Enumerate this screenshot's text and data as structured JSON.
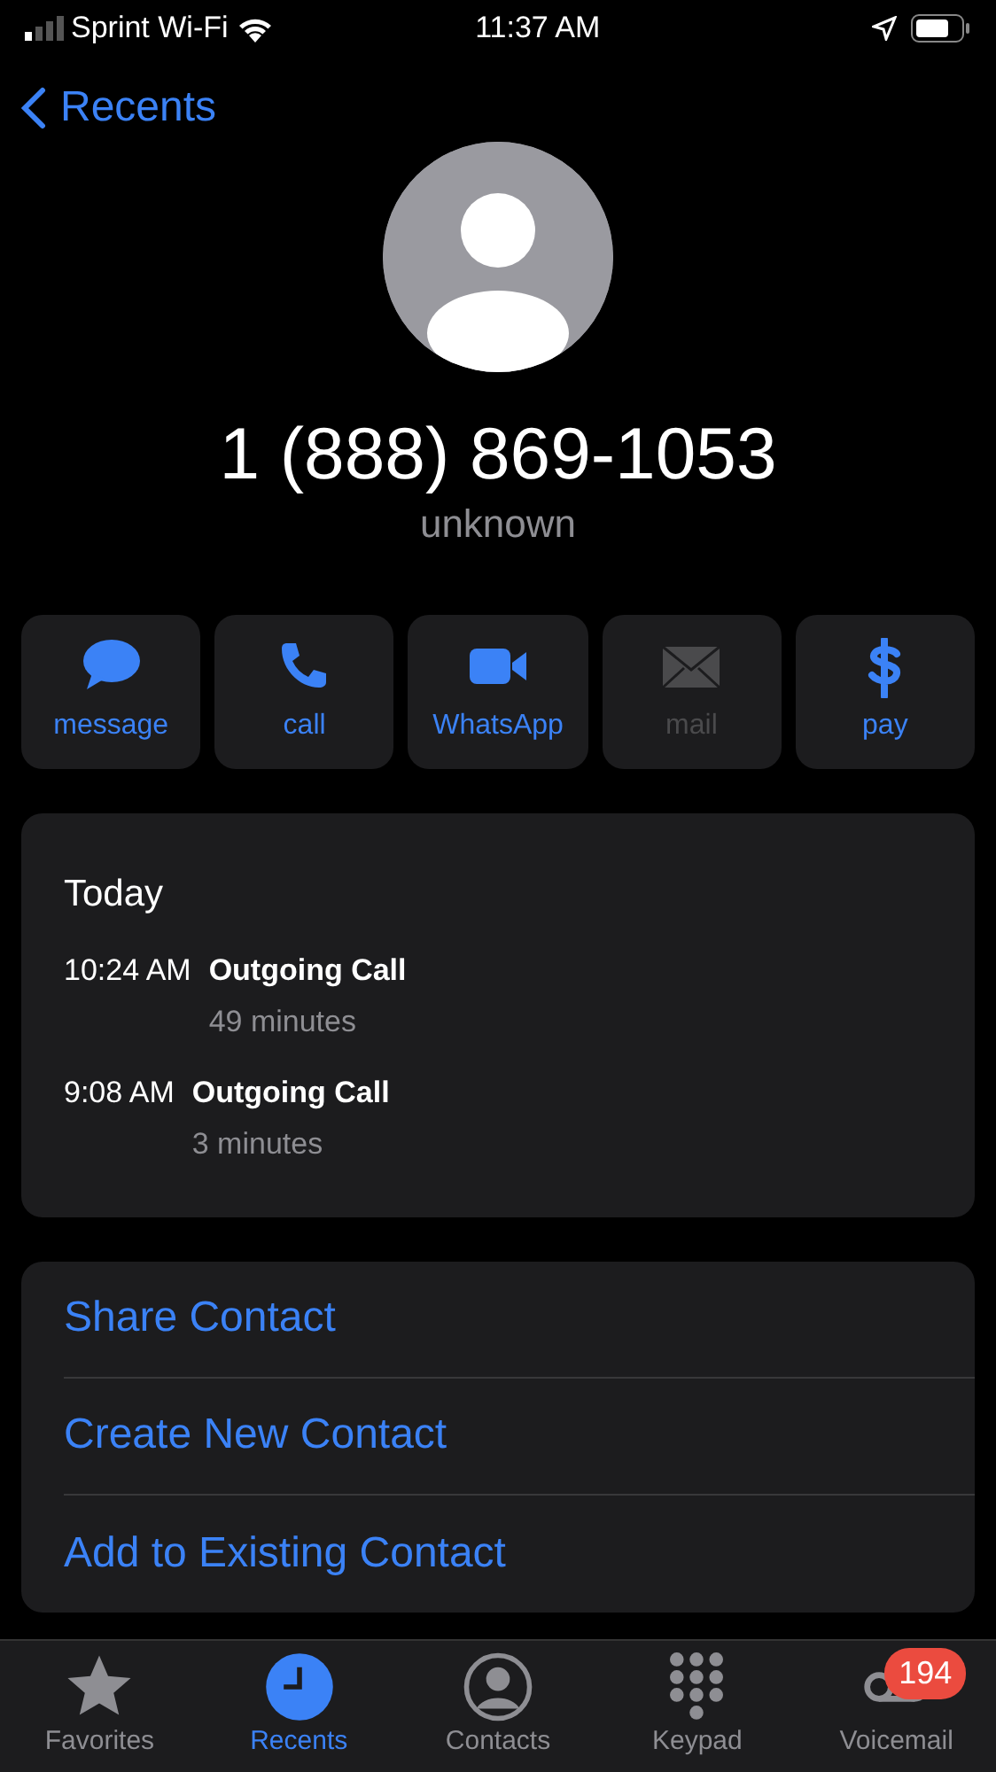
{
  "status_bar": {
    "carrier": "Sprint Wi-Fi",
    "time": "11:37 AM"
  },
  "back": {
    "label": "Recents"
  },
  "contact": {
    "number": "1 (888) 869-1053",
    "label": "unknown"
  },
  "actions": [
    {
      "kind": "message",
      "label": "message",
      "disabled": false
    },
    {
      "kind": "call",
      "label": "call",
      "disabled": false
    },
    {
      "kind": "video",
      "label": "WhatsApp",
      "disabled": false
    },
    {
      "kind": "mail",
      "label": "mail",
      "disabled": true
    },
    {
      "kind": "pay",
      "label": "pay",
      "disabled": false
    }
  ],
  "history": {
    "heading": "Today",
    "calls": [
      {
        "time": "10:24 AM",
        "type": "Outgoing Call",
        "duration": "49 minutes"
      },
      {
        "time": "9:08 AM",
        "type": "Outgoing Call",
        "duration": "3 minutes"
      }
    ]
  },
  "links": [
    "Share Contact",
    "Create New Contact",
    "Add to Existing Contact"
  ],
  "tabs": [
    {
      "kind": "favorites",
      "label": "Favorites",
      "selected": false
    },
    {
      "kind": "recents",
      "label": "Recents",
      "selected": true
    },
    {
      "kind": "contacts",
      "label": "Contacts",
      "selected": false
    },
    {
      "kind": "keypad",
      "label": "Keypad",
      "selected": false
    },
    {
      "kind": "voicemail",
      "label": "Voicemail",
      "selected": false,
      "badge": "194"
    }
  ]
}
